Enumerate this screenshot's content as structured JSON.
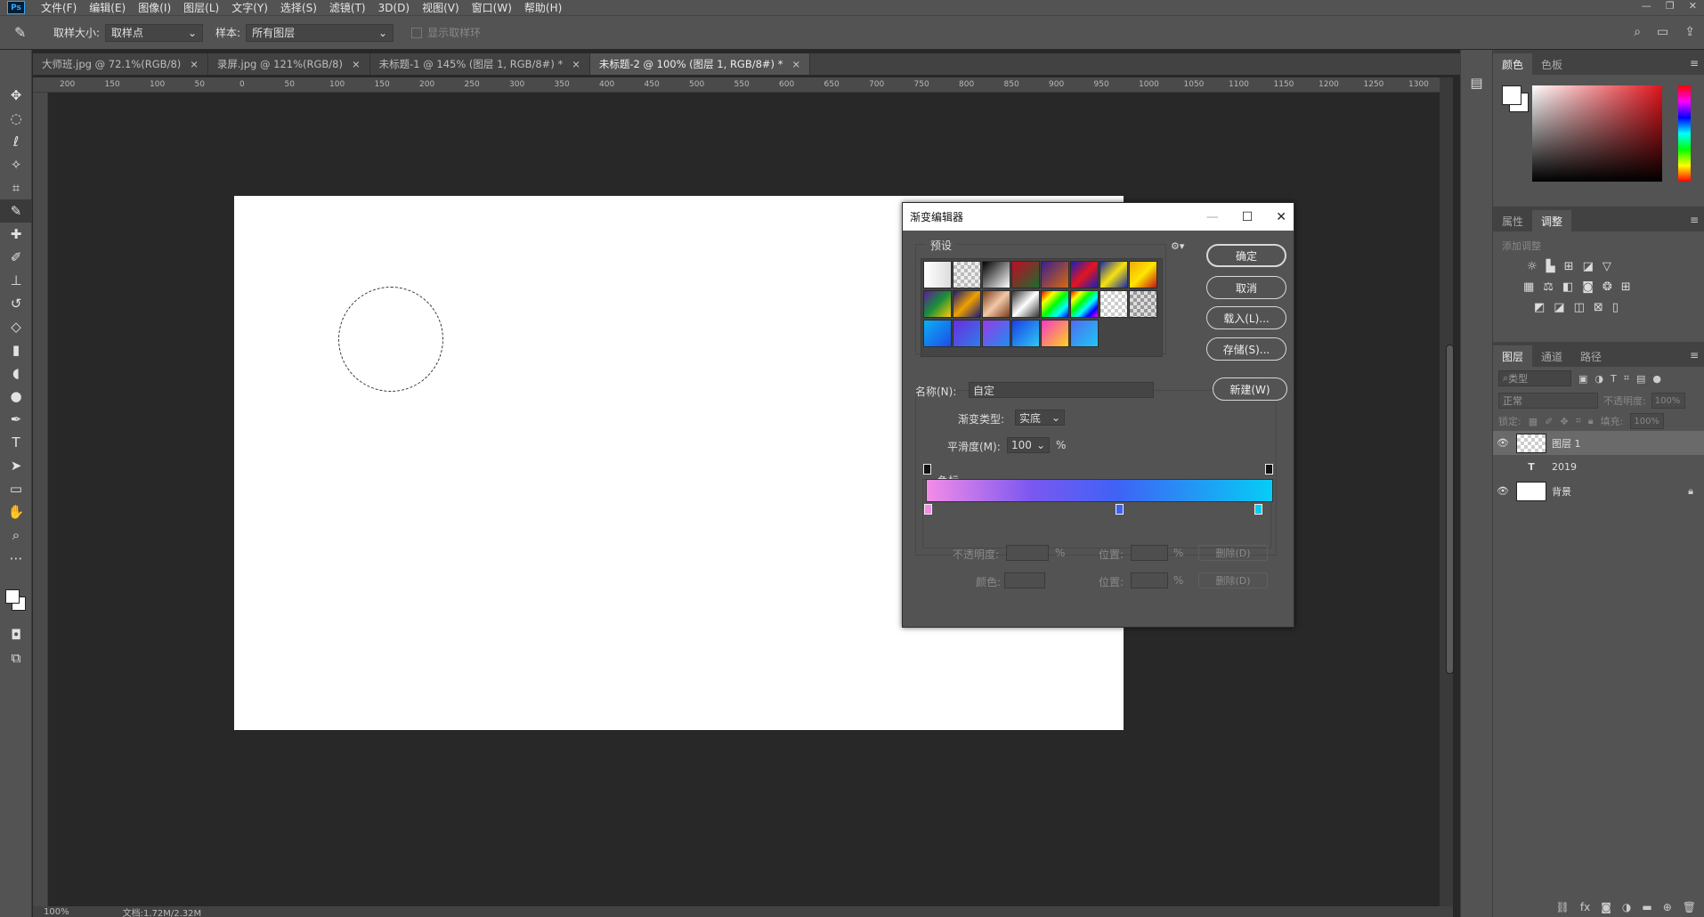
{
  "menu": {
    "logo": "Ps",
    "items": [
      "文件(F)",
      "编辑(E)",
      "图像(I)",
      "图层(L)",
      "文字(Y)",
      "选择(S)",
      "滤镜(T)",
      "3D(D)",
      "视图(V)",
      "窗口(W)",
      "帮助(H)"
    ]
  },
  "options": {
    "sample_size_label": "取样大小:",
    "sample_size_value": "取样点",
    "sample_label": "样本:",
    "sample_value": "所有图层",
    "show_ring_label": "显示取样环"
  },
  "tabs": [
    {
      "label": "大师班.jpg @ 72.1%(RGB/8)"
    },
    {
      "label": "录屏.jpg @ 121%(RGB/8)"
    },
    {
      "label": "未标题-1 @ 145% (图层 1, RGB/8#) *"
    },
    {
      "label": "未标题-2 @ 100% (图层 1, RGB/8#) *"
    }
  ],
  "ruler_ticks": [
    "200",
    "150",
    "100",
    "50",
    "0",
    "50",
    "100",
    "150",
    "200",
    "250",
    "300",
    "350",
    "400",
    "450",
    "500",
    "550",
    "600",
    "650",
    "700",
    "750",
    "800",
    "850",
    "900",
    "950",
    "1000",
    "1050",
    "1100",
    "1150",
    "1200",
    "1250",
    "1300"
  ],
  "status": {
    "zoom": "100%",
    "doc": "文档:1.72M/2.32M"
  },
  "panels": {
    "color_tabs": [
      "颜色",
      "色板"
    ],
    "adj_tabs": [
      "属性",
      "调整"
    ],
    "adj_title": "添加调整",
    "layer_tabs": [
      "图层",
      "通道",
      "路径"
    ],
    "layer_filter": "类型",
    "blend_mode": "正常",
    "opacity_label": "不透明度:",
    "opacity_value": "100%",
    "lock_label": "锁定:",
    "fill_label": "填充:",
    "fill_value": "100%",
    "layers": [
      {
        "name": "图层 1"
      },
      {
        "name": "2019"
      },
      {
        "name": "背景"
      }
    ]
  },
  "dialog": {
    "title": "渐变编辑器",
    "presets_label": "预设",
    "ok": "确定",
    "cancel": "取消",
    "load": "载入(L)...",
    "save": "存储(S)...",
    "name_label": "名称(N):",
    "name_value": "自定",
    "new": "新建(W)",
    "type_label": "渐变类型:",
    "type_value": "实底",
    "smooth_label": "平滑度(M):",
    "smooth_value": "100",
    "percent": "%",
    "stops_label": "色标",
    "opacity_label": "不透明度:",
    "position_label": "位置:",
    "delete": "删除(D)",
    "color_label": "颜色:",
    "colors": {
      "start": "#f48ce8",
      "mid": "#3f62f5",
      "end": "#06cdf5"
    }
  }
}
